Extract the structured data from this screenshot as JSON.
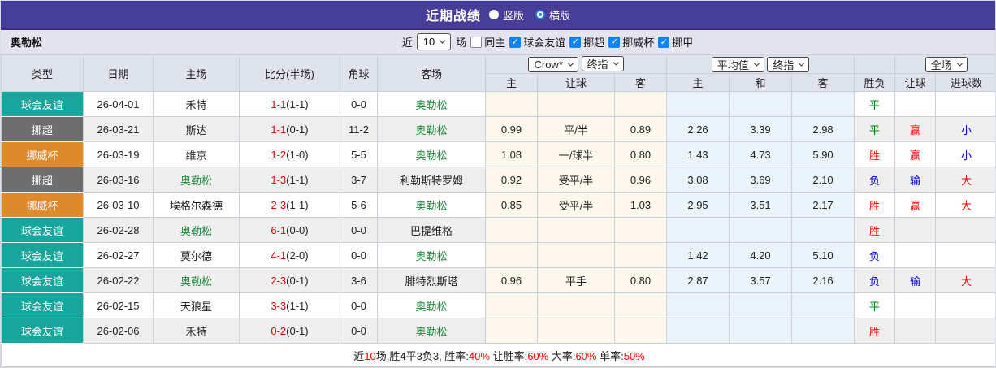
{
  "title_bar": {
    "title": "近期战绩",
    "vertical_label": "竖版",
    "horizontal_label": "横版",
    "selected": "横版"
  },
  "team_bar": {
    "team": "奥勒松",
    "recent_label": "近",
    "recent_count": "10",
    "unit_label": "场",
    "same_home": {
      "label": "同主",
      "checked": false
    },
    "filters": [
      {
        "label": "球会友谊",
        "checked": true
      },
      {
        "label": "挪超",
        "checked": true
      },
      {
        "label": "挪威杯",
        "checked": true
      },
      {
        "label": "挪甲",
        "checked": true
      }
    ]
  },
  "table": {
    "left_headers": [
      "类型",
      "日期",
      "主场",
      "比分(半场)",
      "角球",
      "客场"
    ],
    "group_selects": {
      "odds_source": "Crow*",
      "odds_final": "终指",
      "avg": "平均值",
      "avg_final": "终指",
      "scope": "全场"
    },
    "sub_headers": [
      "主",
      "让球",
      "客",
      "主",
      "和",
      "客",
      "胜负",
      "让球",
      "进球数"
    ],
    "type_colors": {
      "球会友谊": "#18a69c",
      "挪超": "#6e6e6e",
      "挪威杯": "#df8a2d"
    },
    "result_colors": {
      "red": "#ff0000",
      "blue": "#0000ee",
      "green": "#008000"
    },
    "rows": [
      {
        "type": "球会友谊",
        "date": "26-04-01",
        "home": "禾特",
        "home_focus": false,
        "score": "1-1",
        "half": "(1-1)",
        "corner": "0-0",
        "away": "奥勒松",
        "away_focus": true,
        "o_home": "",
        "o_line": "",
        "o_away": "",
        "a_home": "",
        "a_draw": "",
        "a_away": "",
        "wdl": "平",
        "wdl_c": "green",
        "hc": "",
        "hc_c": "",
        "goal": "",
        "goal_c": ""
      },
      {
        "type": "挪超",
        "date": "26-03-21",
        "home": "斯达",
        "home_focus": false,
        "score": "1-1",
        "half": "(0-1)",
        "corner": "11-2",
        "away": "奥勒松",
        "away_focus": true,
        "o_home": "0.99",
        "o_line": "平/半",
        "o_away": "0.89",
        "a_home": "2.26",
        "a_draw": "3.39",
        "a_away": "2.98",
        "wdl": "平",
        "wdl_c": "green",
        "hc": "赢",
        "hc_c": "red",
        "goal": "小",
        "goal_c": "blue"
      },
      {
        "type": "挪威杯",
        "date": "26-03-19",
        "home": "维京",
        "home_focus": false,
        "score": "1-2",
        "half": "(1-0)",
        "corner": "5-5",
        "away": "奥勒松",
        "away_focus": true,
        "o_home": "1.08",
        "o_line": "一/球半",
        "o_away": "0.80",
        "a_home": "1.43",
        "a_draw": "4.73",
        "a_away": "5.90",
        "wdl": "胜",
        "wdl_c": "red",
        "hc": "赢",
        "hc_c": "red",
        "goal": "小",
        "goal_c": "blue"
      },
      {
        "type": "挪超",
        "date": "26-03-16",
        "home": "奥勒松",
        "home_focus": true,
        "score": "1-3",
        "half": "(1-1)",
        "corner": "3-7",
        "away": "利勒斯特罗姆",
        "away_focus": false,
        "o_home": "0.92",
        "o_line": "受平/半",
        "o_away": "0.96",
        "a_home": "3.08",
        "a_draw": "3.69",
        "a_away": "2.10",
        "wdl": "负",
        "wdl_c": "blue",
        "hc": "输",
        "hc_c": "blue",
        "goal": "大",
        "goal_c": "red"
      },
      {
        "type": "挪威杯",
        "date": "26-03-10",
        "home": "埃格尔森德",
        "home_focus": false,
        "score": "2-3",
        "half": "(1-1)",
        "corner": "5-6",
        "away": "奥勒松",
        "away_focus": true,
        "o_home": "0.85",
        "o_line": "受平/半",
        "o_away": "1.03",
        "a_home": "2.95",
        "a_draw": "3.51",
        "a_away": "2.17",
        "wdl": "胜",
        "wdl_c": "red",
        "hc": "赢",
        "hc_c": "red",
        "goal": "大",
        "goal_c": "red"
      },
      {
        "type": "球会友谊",
        "date": "26-02-28",
        "home": "奥勒松",
        "home_focus": true,
        "score": "6-1",
        "half": "(0-0)",
        "corner": "0-0",
        "away": "巴提维格",
        "away_focus": false,
        "o_home": "",
        "o_line": "",
        "o_away": "",
        "a_home": "",
        "a_draw": "",
        "a_away": "",
        "wdl": "胜",
        "wdl_c": "red",
        "hc": "",
        "hc_c": "",
        "goal": "",
        "goal_c": ""
      },
      {
        "type": "球会友谊",
        "date": "26-02-27",
        "home": "莫尔德",
        "home_focus": false,
        "score": "4-1",
        "half": "(2-0)",
        "corner": "0-0",
        "away": "奥勒松",
        "away_focus": true,
        "o_home": "",
        "o_line": "",
        "o_away": "",
        "a_home": "1.42",
        "a_draw": "4.20",
        "a_away": "5.10",
        "wdl": "负",
        "wdl_c": "blue",
        "hc": "",
        "hc_c": "",
        "goal": "",
        "goal_c": ""
      },
      {
        "type": "球会友谊",
        "date": "26-02-22",
        "home": "奥勒松",
        "home_focus": true,
        "score": "2-3",
        "half": "(0-1)",
        "corner": "3-6",
        "away": "腓特烈斯塔",
        "away_focus": false,
        "o_home": "0.96",
        "o_line": "平手",
        "o_away": "0.80",
        "a_home": "2.87",
        "a_draw": "3.57",
        "a_away": "2.16",
        "wdl": "负",
        "wdl_c": "blue",
        "hc": "输",
        "hc_c": "blue",
        "goal": "大",
        "goal_c": "red"
      },
      {
        "type": "球会友谊",
        "date": "26-02-15",
        "home": "天狼星",
        "home_focus": false,
        "score": "3-3",
        "half": "(1-1)",
        "corner": "0-0",
        "away": "奥勒松",
        "away_focus": true,
        "o_home": "",
        "o_line": "",
        "o_away": "",
        "a_home": "",
        "a_draw": "",
        "a_away": "",
        "wdl": "平",
        "wdl_c": "green",
        "hc": "",
        "hc_c": "",
        "goal": "",
        "goal_c": ""
      },
      {
        "type": "球会友谊",
        "date": "26-02-06",
        "home": "禾特",
        "home_focus": false,
        "score": "0-2",
        "half": "(0-1)",
        "corner": "0-0",
        "away": "奥勒松",
        "away_focus": true,
        "o_home": "",
        "o_line": "",
        "o_away": "",
        "a_home": "",
        "a_draw": "",
        "a_away": "",
        "wdl": "胜",
        "wdl_c": "red",
        "hc": "",
        "hc_c": "",
        "goal": "",
        "goal_c": ""
      }
    ]
  },
  "footer": {
    "segments": [
      {
        "text": "近",
        "red": false
      },
      {
        "text": "10",
        "red": true
      },
      {
        "text": "场,胜4平3负3, 胜率:",
        "red": false
      },
      {
        "text": "40%",
        "red": true
      },
      {
        "text": " 让胜率:",
        "red": false
      },
      {
        "text": "60%",
        "red": true
      },
      {
        "text": " 大率:",
        "red": false
      },
      {
        "text": "60%",
        "red": true
      },
      {
        "text": " 单率:",
        "red": false
      },
      {
        "text": "50%",
        "red": true
      }
    ]
  }
}
